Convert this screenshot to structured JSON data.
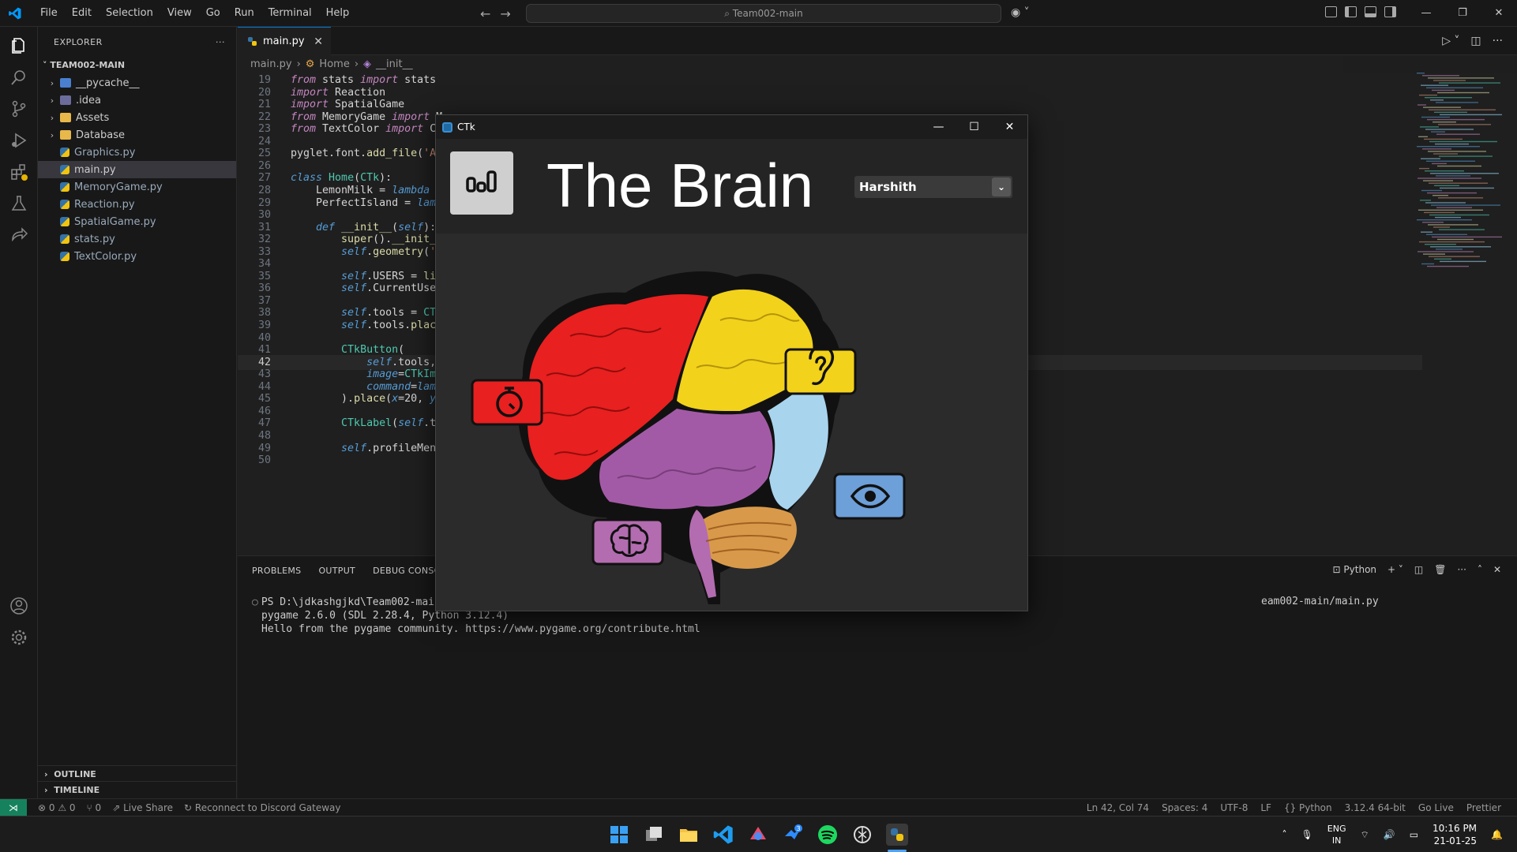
{
  "vscode": {
    "menu": [
      "File",
      "Edit",
      "Selection",
      "View",
      "Go",
      "Run",
      "Terminal",
      "Help"
    ],
    "command_center": "Team002-main",
    "explorer": {
      "header": "EXPLORER",
      "root": "TEAM002-MAIN",
      "items": [
        {
          "label": "__pycache__",
          "type": "folder"
        },
        {
          "label": ".idea",
          "type": "folder"
        },
        {
          "label": "Assets",
          "type": "folder"
        },
        {
          "label": "Database",
          "type": "folder"
        },
        {
          "label": "Graphics.py",
          "type": "py"
        },
        {
          "label": "main.py",
          "type": "py",
          "active": true
        },
        {
          "label": "MemoryGame.py",
          "type": "py"
        },
        {
          "label": "Reaction.py",
          "type": "py"
        },
        {
          "label": "SpatialGame.py",
          "type": "py"
        },
        {
          "label": "stats.py",
          "type": "py"
        },
        {
          "label": "TextColor.py",
          "type": "py"
        }
      ],
      "outline": "OUTLINE",
      "timeline": "TIMELINE"
    },
    "tab": {
      "label": "main.py",
      "close": "✕"
    },
    "breadcrumb": [
      "main.py",
      "Home",
      "__init__"
    ],
    "code_lines": [
      {
        "n": "19",
        "html": "<span class='kw'>from</span> stats <span class='kw'>import</span> stats"
      },
      {
        "n": "20",
        "html": "<span class='kw'>import</span> Reaction"
      },
      {
        "n": "21",
        "html": "<span class='kw'>import</span> SpatialGame"
      },
      {
        "n": "22",
        "html": "<span class='kw'>from</span> MemoryGame <span class='kw'>import</span> M"
      },
      {
        "n": "23",
        "html": "<span class='kw'>from</span> TextColor <span class='kw'>import</span> Co"
      },
      {
        "n": "24",
        "html": ""
      },
      {
        "n": "25",
        "html": "pyglet.font.<span class='fn'>add_file</span>(<span class='str'>'As</span>"
      },
      {
        "n": "26",
        "html": ""
      },
      {
        "n": "27",
        "html": "<span class='kw2'>class</span> <span class='cls'>Home</span>(<span class='cls'>CTk</span>):"
      },
      {
        "n": "28",
        "html": "    LemonMilk = <span class='kw2'>lambda</span> s"
      },
      {
        "n": "29",
        "html": "    PerfectIsland = <span class='kw2'>lamb</span>"
      },
      {
        "n": "30",
        "html": ""
      },
      {
        "n": "31",
        "html": "    <span class='kw2'>def</span> <span class='fn'>__init__</span>(<span class='self'>self</span>):"
      },
      {
        "n": "32",
        "html": "        <span class='fn'>super</span>().<span class='fn'>__init__</span>"
      },
      {
        "n": "33",
        "html": "        <span class='self'>self</span>.<span class='fn'>geometry</span>(<span class='str'>'7</span>"
      },
      {
        "n": "34",
        "html": ""
      },
      {
        "n": "35",
        "html": "        <span class='self'>self</span>.USERS = <span class='fn'>lis</span>"
      },
      {
        "n": "36",
        "html": "        <span class='self'>self</span>.CurrentUser"
      },
      {
        "n": "37",
        "html": ""
      },
      {
        "n": "38",
        "html": "        <span class='self'>self</span>.tools = <span class='cls'>CTk</span>"
      },
      {
        "n": "39",
        "html": "        <span class='self'>self</span>.tools.<span class='fn'>place</span>"
      },
      {
        "n": "40",
        "html": ""
      },
      {
        "n": "41",
        "html": "        <span class='cls'>CTkButton</span>("
      },
      {
        "n": "42",
        "html": "            <span class='self'>self</span>.tools,"
      },
      {
        "n": "43",
        "html": "            <span class='self'>image</span>=<span class='cls'>CTkIma</span>"
      },
      {
        "n": "44",
        "html": "            <span class='self'>command</span>=<span class='kw2'>lamb</span>"
      },
      {
        "n": "45",
        "html": "        ).<span class='fn'>place</span>(<span class='self'>x</span>=20, <span class='self'>y</span>="
      },
      {
        "n": "46",
        "html": ""
      },
      {
        "n": "47",
        "html": "        <span class='cls'>CTkLabel</span>(<span class='self'>self</span>.to"
      },
      {
        "n": "48",
        "html": ""
      },
      {
        "n": "49",
        "html": "        <span class='self'>self</span>.profileMenu"
      },
      {
        "n": "50",
        "html": ""
      }
    ],
    "current_line": "42",
    "panel": {
      "tabs": [
        "PROBLEMS",
        "OUTPUT",
        "DEBUG CONSOLE"
      ],
      "shell": "Python",
      "terminal": [
        "PS D:\\jdkashgjkd\\Team002-main\\Tea",
        "pygame 2.6.0 (SDL 2.28.4, Python 3.12.4)",
        "Hello from the pygame community. https://www.pygame.org/contribute.html"
      ],
      "terminal_right": "eam002-main/main.py"
    },
    "status": {
      "left": [
        "⊗ 0 ⚠ 0",
        "⑂ 0",
        "Live Share",
        "Reconnect to Discord Gateway"
      ],
      "right": [
        "Ln 42, Col 74",
        "Spaces: 4",
        "UTF-8",
        "LF",
        "{} Python",
        "3.12.4 64-bit",
        "Go Live",
        "Prettier"
      ]
    }
  },
  "ctk": {
    "title": "CTk",
    "heading": "The Brain",
    "profile": "Harshith",
    "win_min": "—",
    "win_max": "☐",
    "win_close": "✕"
  },
  "taskbar": {
    "lang_top": "ENG",
    "lang_bottom": "IN",
    "time": "10:16 PM",
    "date": "21-01-25",
    "badge": "3"
  },
  "colors": {
    "accent": "#0078d4",
    "red_lobe": "#e82020",
    "yellow_lobe": "#f2d21b",
    "purple_lobe": "#a35aa6",
    "blue_lobe": "#a8d4ee",
    "cerebellum": "#d89a4a"
  }
}
